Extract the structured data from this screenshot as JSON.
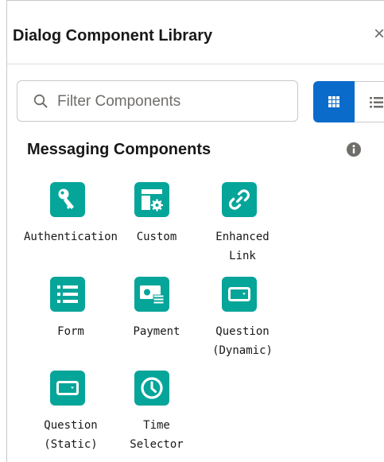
{
  "header": {
    "title": "Dialog Component Library",
    "close_glyph": "×"
  },
  "search": {
    "placeholder": "Filter Components",
    "value": ""
  },
  "view_toggle": {
    "active": "grid",
    "options": [
      "grid-view-icon",
      "list-view-icon"
    ]
  },
  "section": {
    "title": "Messaging Components"
  },
  "colors": {
    "tile": "#06a59a",
    "accent": "#0b6bcb"
  },
  "components": [
    {
      "label": "Authentication",
      "icon": "key-icon"
    },
    {
      "label": "Custom",
      "icon": "custom-layout-icon"
    },
    {
      "label": "Enhanced\nLink",
      "icon": "link-icon"
    },
    {
      "label": "Form",
      "icon": "form-list-icon"
    },
    {
      "label": "Payment",
      "icon": "payment-icon"
    },
    {
      "label": "Question\n(Dynamic)",
      "icon": "dropdown-icon"
    },
    {
      "label": "Question\n(Static)",
      "icon": "dropdown-icon"
    },
    {
      "label": "Time\nSelector",
      "icon": "clock-icon"
    }
  ]
}
